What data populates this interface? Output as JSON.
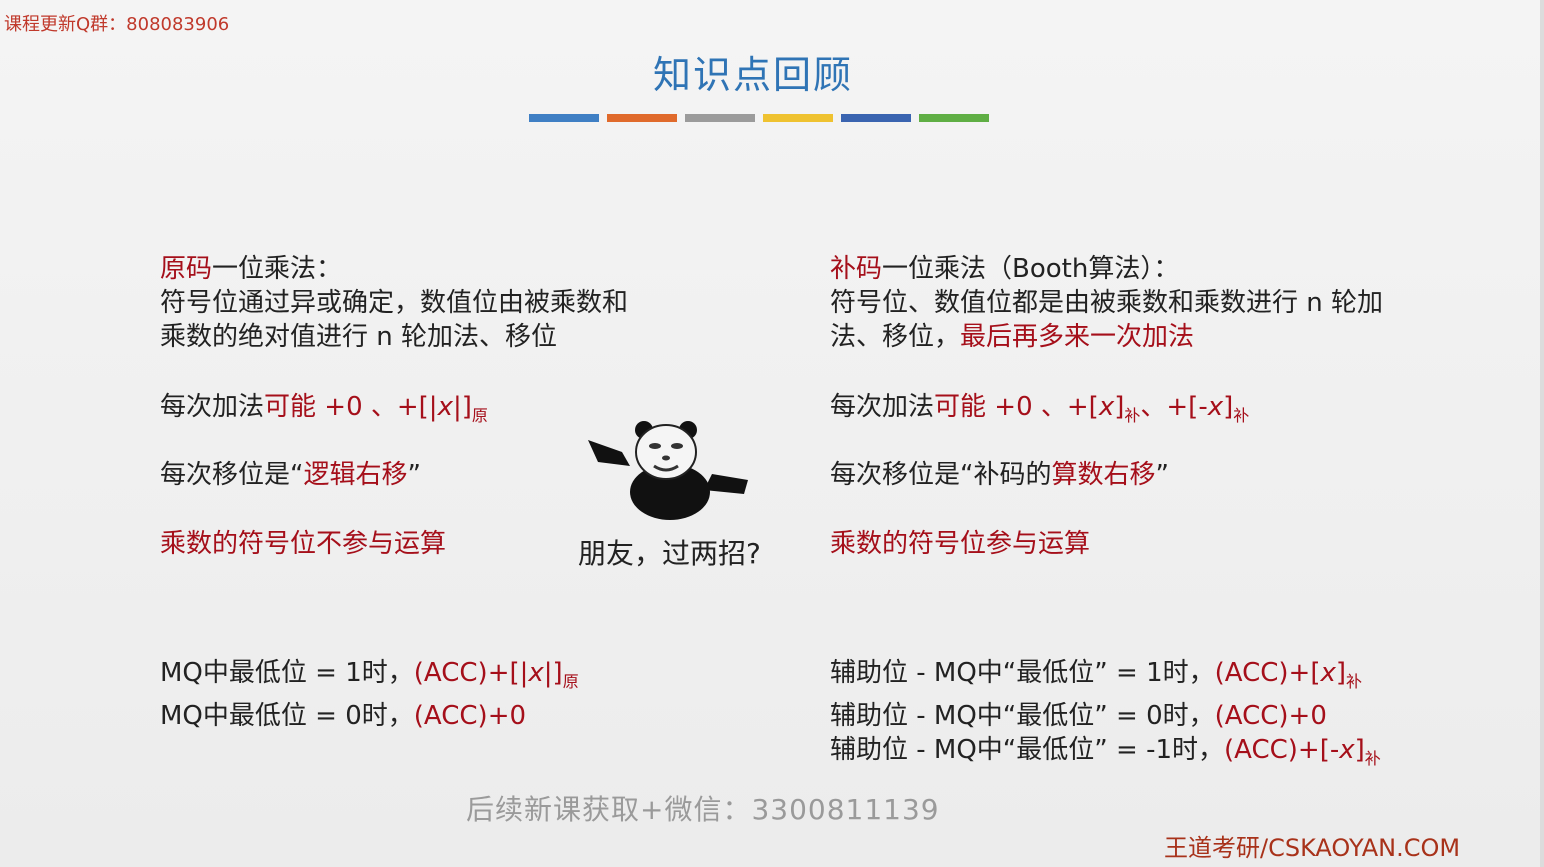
{
  "qq_group": "课程更新Q群：808083906",
  "title": "知识点回顾",
  "colors": {
    "title": "#2f74b5",
    "red": "#a50f1a",
    "bars": [
      "#3f7fc4",
      "#e06a2b",
      "#9b9b9b",
      "#efc230",
      "#3a64b0",
      "#5fae44"
    ]
  },
  "left": {
    "heading_red": "原码",
    "heading_rest": "一位乘法：",
    "desc_1": "符号位通过异或确定，数值位由被乘数和",
    "desc_2": "乘数的绝对值进行 n 轮加法、移位",
    "add_prefix": "每次加法",
    "add_red": "可能 +0 、+[|",
    "add_x": "x",
    "add_end": "|]",
    "add_sub": "原",
    "shift_prefix": "每次移位是“",
    "shift_red": "逻辑右移",
    "shift_suffix": "”",
    "sign_note": "乘数的符号位不参与运算",
    "rule1_prefix": "MQ中最低位 = 1时，",
    "rule1_red": "(ACC)+[|",
    "rule1_x": "x",
    "rule1_end": "|]",
    "rule1_sub": "原",
    "rule2_prefix": "MQ中最低位 = 0时，",
    "rule2_red": "(ACC)+0"
  },
  "right": {
    "heading_red": "补码",
    "heading_rest": "一位乘法（Booth算法）：",
    "desc_1": "符号位、数值位都是由被乘数和乘数进行 n 轮加",
    "desc_2_black": "法、移位，",
    "desc_2_red": "最后再多来一次加法",
    "add_prefix": "每次加法",
    "add_red1": "可能 +0 、+[",
    "add_x1": "x",
    "add_end1": "]",
    "add_sub1": "补",
    "add_sep": "、",
    "add_red2": "+[-",
    "add_x2": "x",
    "add_end2": "]",
    "add_sub2": "补",
    "shift_prefix": "每次移位是“补码的",
    "shift_red": "算数右移",
    "shift_suffix": "”",
    "sign_note": "乘数的符号位参与运算",
    "rule1_prefix": "辅助位 - MQ中“最低位” = 1时，",
    "rule1_red": "(ACC)+[",
    "rule1_x": "x",
    "rule1_end": "]",
    "rule1_sub": "补",
    "rule2_prefix": "辅助位 - MQ中“最低位” = 0时，",
    "rule2_red": "(ACC)+0",
    "rule3_prefix": "辅助位 - MQ中“最低位” = -1时，",
    "rule3_red": "(ACC)+[-",
    "rule3_x": "x",
    "rule3_end": "]",
    "rule3_sub": "补"
  },
  "meme_caption": "朋友，过两招?",
  "watermark": "后续新课获取+微信：3300811139",
  "site": "王道考研/CSKAOYAN.COM"
}
